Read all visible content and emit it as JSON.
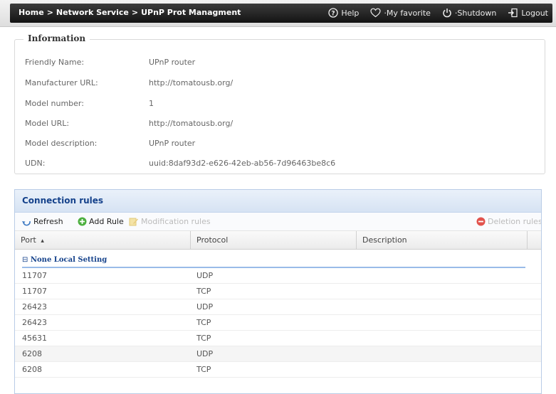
{
  "header": {
    "breadcrumb": [
      "Home",
      "Network Service",
      "UPnP Prot Managment"
    ],
    "separator": ">",
    "links": {
      "help": "Help",
      "favorite": "My favorite",
      "shutdown": "Shutdown",
      "logout": "Logout"
    }
  },
  "info": {
    "title": "Information",
    "rows": [
      {
        "label": "Friendly Name:",
        "value": "UPnP router"
      },
      {
        "label": "Manufacturer URL:",
        "value": "http://tomatousb.org/"
      },
      {
        "label": "Model number:",
        "value": "1"
      },
      {
        "label": "Model URL:",
        "value": "http://tomatousb.org/"
      },
      {
        "label": "Model description:",
        "value": "UPnP router"
      },
      {
        "label": "UDN:",
        "value": "uuid:8daf93d2-e626-42eb-ab56-7d96463be8c6"
      }
    ]
  },
  "rules": {
    "title": "Connection rules",
    "toolbar": {
      "refresh": "Refresh",
      "add": "Add Rule",
      "modify": "Modification rules",
      "delete": "Deletion rules"
    },
    "columns": {
      "port": "Port",
      "sort_indicator": "▴",
      "protocol": "Protocol",
      "description": "Description"
    },
    "group": {
      "toggle": "⊟",
      "label": "None Local Setting"
    },
    "rows": [
      {
        "port": "11707",
        "protocol": "UDP",
        "description": ""
      },
      {
        "port": "11707",
        "protocol": "TCP",
        "description": ""
      },
      {
        "port": "26423",
        "protocol": "UDP",
        "description": ""
      },
      {
        "port": "26423",
        "protocol": "TCP",
        "description": ""
      },
      {
        "port": "45631",
        "protocol": "TCP",
        "description": ""
      },
      {
        "port": "6208",
        "protocol": "UDP",
        "description": ""
      },
      {
        "port": "6208",
        "protocol": "TCP",
        "description": ""
      }
    ],
    "highlighted_row": 5
  }
}
